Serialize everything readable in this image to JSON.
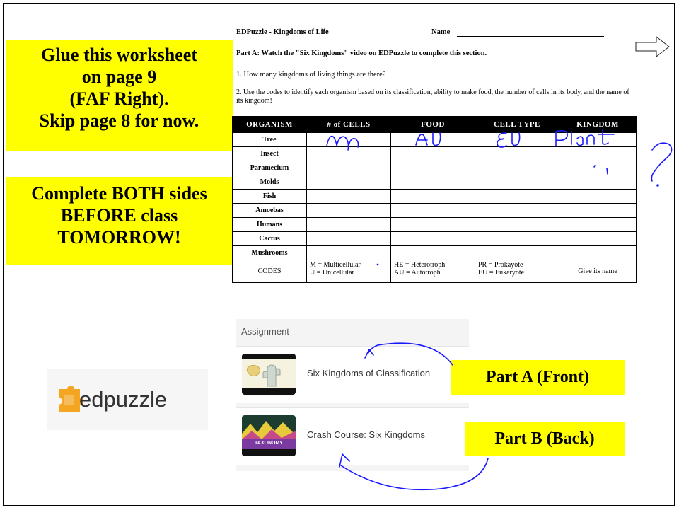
{
  "notes": {
    "glue": [
      "Glue this worksheet",
      "on page 9",
      "(FAF Right).",
      "Skip page 8 for now."
    ],
    "complete": [
      "Complete BOTH sides",
      "BEFORE class",
      "TOMORROW!"
    ]
  },
  "worksheet": {
    "header": "EDPuzzle - Kingdoms of Life",
    "name_label": "Name",
    "part_a": "Part A:  Watch the \"Six Kingdoms\" video on EDPuzzle to complete this section.",
    "q1": "1. How many kingdoms of living things are there?",
    "q2": "2.  Use the codes to identify each organism based on its classification, ability to make food, the number of cells in its body, and the name of its kingdom!",
    "columns": [
      "ORGANISM",
      "# of CELLS",
      "FOOD",
      "CELL TYPE",
      "KINGDOM"
    ],
    "organisms": [
      "Tree",
      "Insect",
      "Paramecium",
      "Molds",
      "Fish",
      "Amoebas",
      "Humans",
      "Cactus",
      "Mushrooms"
    ],
    "codes_label": "CODES",
    "codes": {
      "cells": [
        "M = Multicellular",
        "U = Unicellular"
      ],
      "food": [
        "HE = Heterotroph",
        "AU = Autotroph"
      ],
      "cell_type": [
        "PR = Prokayote",
        "EU = Eukaryote"
      ],
      "kingdom": "Give its name"
    },
    "handwriting": {
      "tree_cells": "M",
      "tree_food": "AU",
      "tree_cell_type": "EU",
      "tree_kingdom": "Plant",
      "margin_mark": "?"
    }
  },
  "assignment": {
    "title": "Assignment",
    "items": [
      {
        "title": "Six Kingdoms of Classification"
      },
      {
        "title": "Crash Course: Six Kingdoms",
        "thumb_text": "TAXONOMY"
      }
    ]
  },
  "logo": {
    "text": "edpuzzle"
  },
  "callouts": {
    "part_a": "Part A (Front)",
    "part_b": "Part B (Back)"
  },
  "colors": {
    "highlight": "#ffff00",
    "ink": "#1a1aff",
    "table_header": "#000000"
  }
}
